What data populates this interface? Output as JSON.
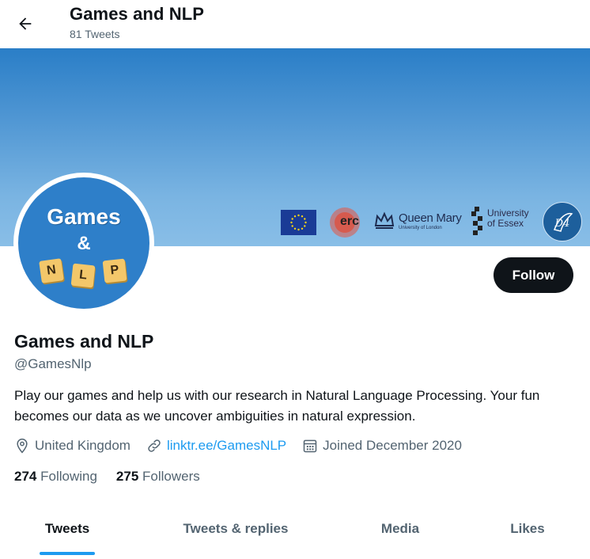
{
  "header": {
    "title": "Games and NLP",
    "subtitle": "81 Tweets",
    "back_icon": "arrow-left-icon"
  },
  "banner": {
    "logos": {
      "erc": "erc",
      "queen_mary": "Queen Mary",
      "queen_mary_sub": "University of London",
      "essex_line1": "University",
      "essex_line2": "of Essex",
      "d4": "D4"
    }
  },
  "avatar": {
    "line1": "Games",
    "line2": "&",
    "tiles": [
      "N",
      "L",
      "P"
    ]
  },
  "follow_label": "Follow",
  "profile": {
    "name": "Games and NLP",
    "handle": "@GamesNlp",
    "bio": "Play our games and help us with our research in Natural Language Processing. Your fun becomes our data as we uncover ambiguities in natural expression.",
    "location": "United Kingdom",
    "link": "linktr.ee/GamesNLP",
    "joined": "Joined December 2020"
  },
  "counts": {
    "following_num": "274",
    "following_label": "Following",
    "followers_num": "275",
    "followers_label": "Followers"
  },
  "tabs": [
    "Tweets",
    "Tweets & replies",
    "Media",
    "Likes"
  ],
  "colors": {
    "accent": "#1d9bf0",
    "text": "#0f1419",
    "muted": "#536471",
    "banner": "#4f96d3"
  }
}
